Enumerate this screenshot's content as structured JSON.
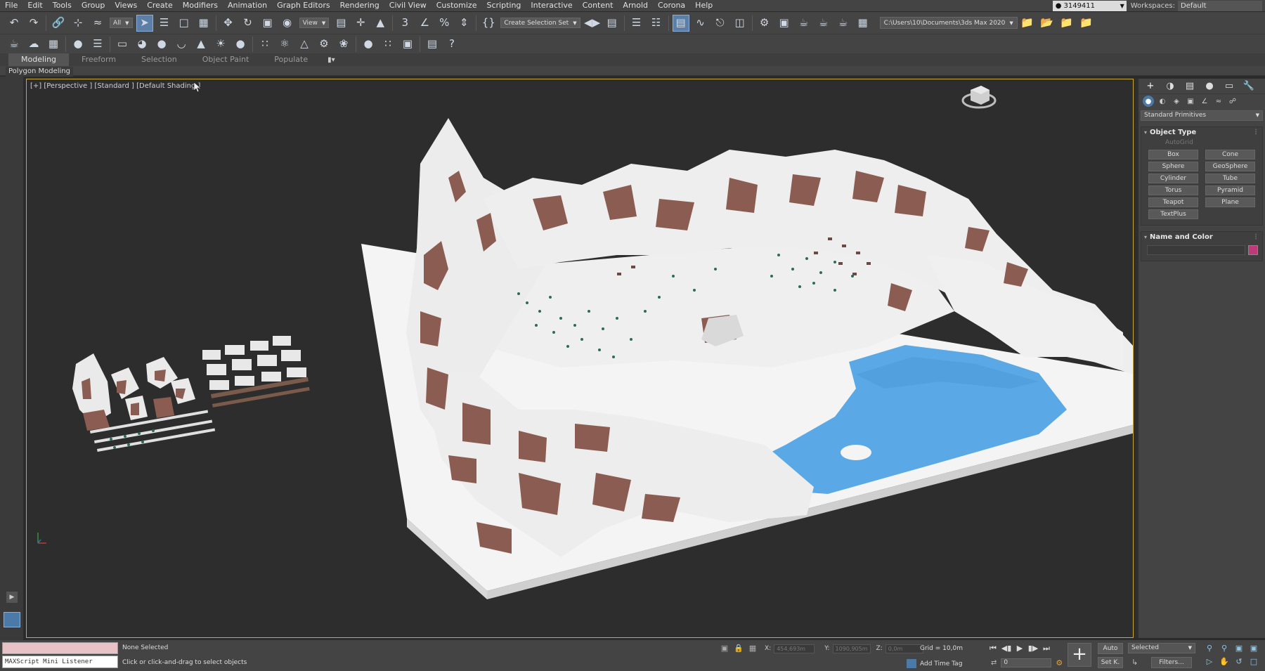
{
  "menu": {
    "items": [
      "File",
      "Edit",
      "Tools",
      "Group",
      "Views",
      "Create",
      "Modifiers",
      "Animation",
      "Graph Editors",
      "Rendering",
      "Civil View",
      "Customize",
      "Scripting",
      "Interactive",
      "Content",
      "Arnold",
      "Corona",
      "Help"
    ],
    "user_id": "3149411",
    "workspaces_label": "Workspaces:",
    "workspace_value": "Default"
  },
  "toolbar": {
    "filter_value": "All",
    "ref_coord_value": "View",
    "selection_set_value": "Create Selection Set",
    "project_path": "C:\\Users\\10\\Documents\\3ds Max 2020"
  },
  "ribbon": {
    "tabs": [
      "Modeling",
      "Freeform",
      "Selection",
      "Object Paint",
      "Populate"
    ],
    "active_tab": "Modeling",
    "sub_label": "Polygon Modeling"
  },
  "viewport": {
    "label": "[+] [Perspective ] [Standard ] [Default Shading ]"
  },
  "command_panel": {
    "category_value": "Standard Primitives",
    "object_type_title": "Object Type",
    "autogrid_label": "AutoGrid",
    "primitives": [
      "Box",
      "Cone",
      "Sphere",
      "GeoSphere",
      "Cylinder",
      "Tube",
      "Torus",
      "Pyramid",
      "Teapot",
      "Plane",
      "TextPlus"
    ],
    "name_color_title": "Name and Color",
    "object_color": "#c0397a"
  },
  "status": {
    "listener_label": "MAXScript Mini Listener",
    "selection_status": "None Selected",
    "prompt": "Click or click-and-drag to select objects",
    "x_label": "X:",
    "x_value": "454,693m",
    "y_label": "Y:",
    "y_value": "1090,905m",
    "z_label": "Z:",
    "z_value": "0,0m",
    "grid": "Grid = 10,0m",
    "add_time_tag": "Add Time Tag",
    "frame_value": "0",
    "auto_label": "Auto",
    "setk_label": "Set K.",
    "key_filter_value": "Selected",
    "filters_label": "Filters..."
  },
  "colors": {
    "ui_bg": "#444444",
    "viewport_bg": "#2d2d2d",
    "viewport_border": "#c8a93a",
    "snow": "#f2f2f2",
    "rock": "#8a5c52",
    "water": "#5aa9e6"
  }
}
